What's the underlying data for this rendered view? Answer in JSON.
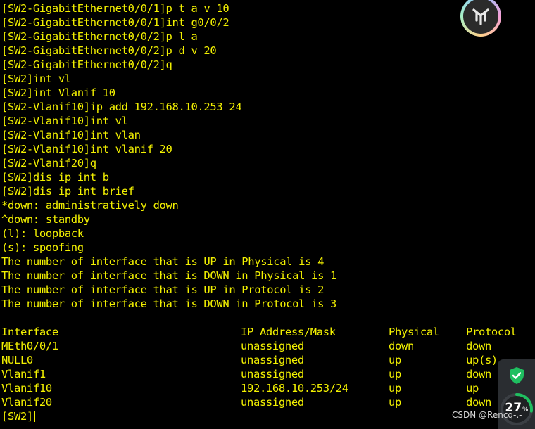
{
  "terminal": {
    "lines": [
      "[SW2-GigabitEthernet0/0/1]p t a v 10",
      "[SW2-GigabitEthernet0/0/1]int g0/0/2",
      "[SW2-GigabitEthernet0/0/2]p l a",
      "[SW2-GigabitEthernet0/0/2]p d v 20",
      "[SW2-GigabitEthernet0/0/2]q",
      "[SW2]int vl",
      "[SW2]int Vlanif 10",
      "[SW2-Vlanif10]ip add 192.168.10.253 24",
      "[SW2-Vlanif10]int vl",
      "[SW2-Vlanif10]int vlan",
      "[SW2-Vlanif10]int vlanif 20",
      "[SW2-Vlanif20]q",
      "[SW2]dis ip int b",
      "[SW2]dis ip int brief",
      "*down: administratively down",
      "^down: standby",
      "(l): loopback",
      "(s): spoofing",
      "The number of interface that is UP in Physical is 4",
      "The number of interface that is DOWN in Physical is 1",
      "The number of interface that is UP in Protocol is 2",
      "The number of interface that is DOWN in Protocol is 3",
      ""
    ],
    "table": {
      "headers": [
        "Interface",
        "IP Address/Mask",
        "Physical",
        "Protocol"
      ],
      "rows": [
        [
          "MEth0/0/1",
          "unassigned",
          "down",
          "down"
        ],
        [
          "NULL0",
          "unassigned",
          "up",
          "up(s)"
        ],
        [
          "Vlanif1",
          "unassigned",
          "up",
          "down"
        ],
        [
          "Vlanif10",
          "192.168.10.253/24",
          "up",
          "up"
        ],
        [
          "Vlanif20",
          "unassigned",
          "up",
          "down"
        ]
      ]
    },
    "prompt": "[SW2]",
    "text_color": "#f2f000",
    "background": "#000000"
  },
  "widget": {
    "percent_value": "27",
    "percent_symbol": "%",
    "usage": 0.27,
    "shield_icon": "shield-check-icon",
    "accent_color": "#1fbf60"
  },
  "corner_logo": {
    "icon": "app-logo-icon"
  },
  "watermark": "CSDN @Rencq-.-"
}
